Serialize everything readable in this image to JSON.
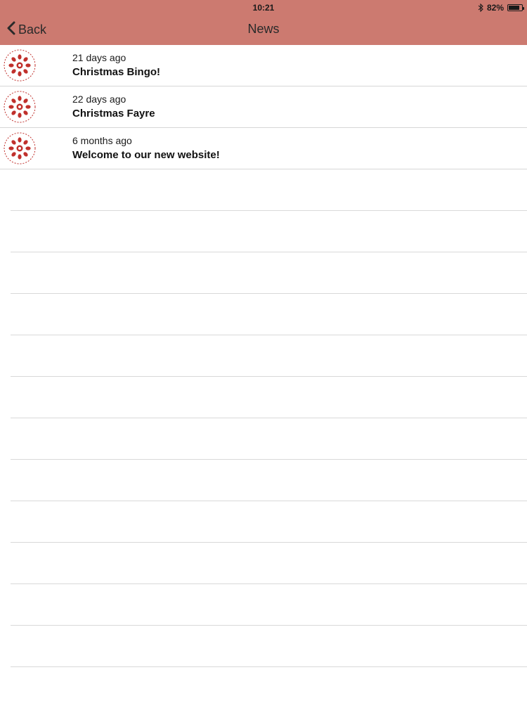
{
  "status_bar": {
    "time": "10:21",
    "battery": "82%",
    "battery_level": 0.82
  },
  "nav": {
    "back_label": "Back",
    "title": "News"
  },
  "colors": {
    "header_bg": "#cc7a70",
    "logo_red": "#c0302c"
  },
  "icons": [
    "chevron-left-icon",
    "bluetooth-icon",
    "battery-icon",
    "school-logo-icon"
  ],
  "news": [
    {
      "date": "21 days ago",
      "title": "Christmas Bingo!"
    },
    {
      "date": "22 days ago",
      "title": "Christmas Fayre"
    },
    {
      "date": "6 months ago",
      "title": "Welcome to our new website!"
    }
  ]
}
